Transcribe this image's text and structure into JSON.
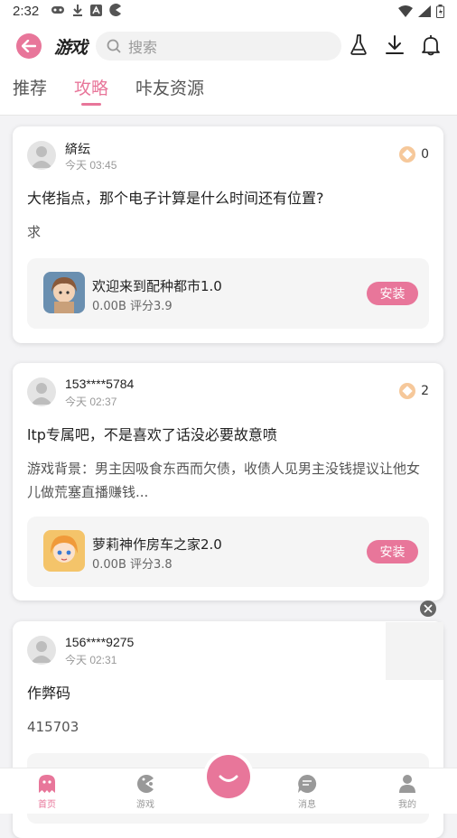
{
  "status": {
    "time": "2:32"
  },
  "header": {
    "logo": "游戏",
    "search_placeholder": "搜索",
    "tabs": [
      {
        "label": "推荐",
        "active": false
      },
      {
        "label": "攻略",
        "active": true
      },
      {
        "label": "咔友资源",
        "active": false
      }
    ]
  },
  "posts": [
    {
      "user": "緕纭",
      "time": "今天 03:45",
      "coins": "0",
      "title": "大佬指点，那个电子计算是什么时间还有位置?",
      "body": "求",
      "game": {
        "name": "欢迎来到配种都市1.0",
        "meta": "0.00B  评分3.9",
        "action": "安装"
      }
    },
    {
      "user": "153****5784",
      "time": "今天 02:37",
      "coins": "2",
      "title": "ltp专属吧，不是喜欢了话没必要故意喷",
      "body": "游戏背景：男主因吸食东西而欠债，收债人见男主没钱提议让他女儿做荒塞直播赚钱...",
      "game": {
        "name": "萝莉神作房车之家2.0",
        "meta": "0.00B  评分3.8",
        "action": "安装"
      }
    },
    {
      "user": "156****9275",
      "time": "今天 02:31",
      "title": "作弊码",
      "body": "415703"
    }
  ],
  "nav": {
    "items": [
      {
        "label": "首页",
        "active": true
      },
      {
        "label": "游戏",
        "active": false
      },
      {
        "label": "消息",
        "active": false
      },
      {
        "label": "我的",
        "active": false
      }
    ]
  },
  "colors": {
    "accent": "#e8769a",
    "coin": "#f6c89a"
  }
}
